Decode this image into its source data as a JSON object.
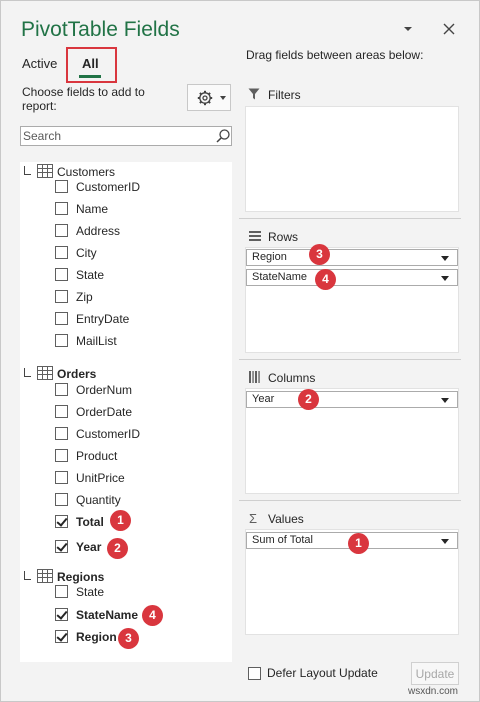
{
  "panel": {
    "title": "PivotTable Fields",
    "tabs": [
      {
        "label": "Active"
      },
      {
        "label": "All"
      }
    ],
    "choose_label": "Choose fields to add to report:",
    "search_placeholder": "Search"
  },
  "tables": [
    {
      "name": "Customers",
      "fields": [
        {
          "label": "CustomerID",
          "checked": false
        },
        {
          "label": "Name",
          "checked": false
        },
        {
          "label": "Address",
          "checked": false
        },
        {
          "label": "City",
          "checked": false
        },
        {
          "label": "State",
          "checked": false
        },
        {
          "label": "Zip",
          "checked": false
        },
        {
          "label": "EntryDate",
          "checked": false
        },
        {
          "label": "MailList",
          "checked": false
        }
      ]
    },
    {
      "name": "Orders",
      "fields": [
        {
          "label": "OrderNum",
          "checked": false
        },
        {
          "label": "OrderDate",
          "checked": false
        },
        {
          "label": "CustomerID",
          "checked": false
        },
        {
          "label": "Product",
          "checked": false
        },
        {
          "label": "UnitPrice",
          "checked": false
        },
        {
          "label": "Quantity",
          "checked": false
        },
        {
          "label": "Total",
          "checked": true,
          "badge": "1"
        },
        {
          "label": "Year",
          "checked": true,
          "badge": "2"
        }
      ]
    },
    {
      "name": "Regions",
      "fields": [
        {
          "label": "State",
          "checked": false
        },
        {
          "label": "StateName",
          "checked": true,
          "badge": "4"
        },
        {
          "label": "Region",
          "checked": true,
          "badge": "3"
        }
      ]
    }
  ],
  "areas": {
    "drag_label": "Drag fields between areas below:",
    "filters": {
      "title": "Filters"
    },
    "rows": {
      "title": "Rows",
      "items": [
        {
          "label": "Region",
          "badge": "3"
        },
        {
          "label": "StateName",
          "badge": "4"
        }
      ]
    },
    "columns": {
      "title": "Columns",
      "items": [
        {
          "label": "Year",
          "badge": "2"
        }
      ]
    },
    "values": {
      "title": "Values",
      "items": [
        {
          "label": "Sum of Total",
          "badge": "1"
        }
      ]
    }
  },
  "footer": {
    "defer_label": "Defer Layout Update",
    "update_label": "Update"
  },
  "watermark": "wsxdn.com",
  "colors": {
    "accent": "#217346",
    "badge": "#d9363e",
    "highlight_box": "#d9363e"
  }
}
